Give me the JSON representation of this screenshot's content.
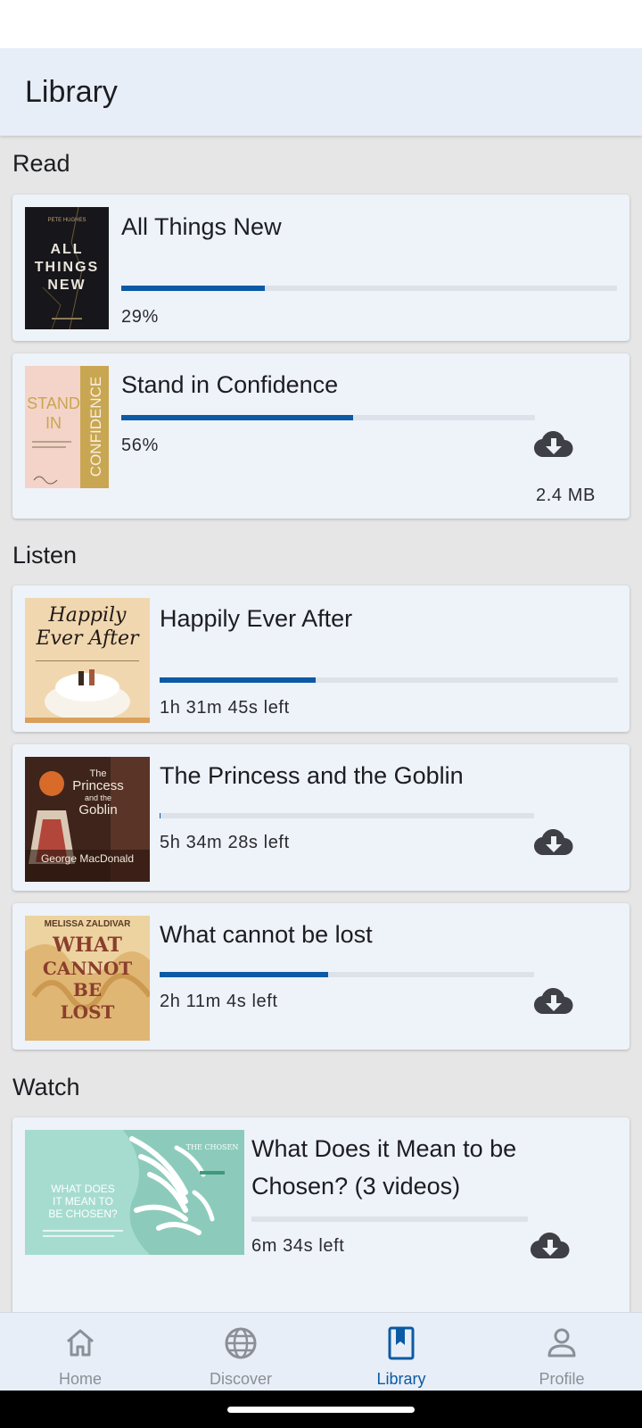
{
  "app_bar": {
    "title": "Library"
  },
  "sections": [
    {
      "title": "Read",
      "items": [
        {
          "title": "All Things New",
          "progress": 0.29,
          "status": "29%",
          "downloadable": false,
          "cover": {
            "author": "PETE HUGHES",
            "lines": [
              "ALL",
              "THINGS",
              "NEW"
            ]
          }
        },
        {
          "title": "Stand in Confidence",
          "progress": 0.56,
          "status": "56%",
          "downloadable": true,
          "size": "2.4 MB",
          "cover": {
            "lines": [
              "STAND",
              "IN"
            ],
            "side": "CONFIDENCE"
          }
        }
      ]
    },
    {
      "title": "Listen",
      "items": [
        {
          "title": "Happily Ever After",
          "progress": 0.34,
          "status": "1h 31m 45s left",
          "downloadable": false,
          "cover": {
            "lines": [
              "Happily",
              "Ever After"
            ]
          }
        },
        {
          "title": "The Princess and the Goblin",
          "progress": 0.003,
          "status": "5h 34m 28s left",
          "downloadable": true,
          "cover": {
            "lines": [
              "The",
              "Princess",
              "and the",
              "Goblin"
            ],
            "author": "George MacDonald"
          }
        },
        {
          "title": "What cannot be lost",
          "progress": 0.45,
          "status": "2h 11m 4s left",
          "downloadable": true,
          "cover": {
            "author": "MELISSA ZALDIVAR",
            "lines": [
              "WHAT",
              "CANNOT",
              "BE",
              "LOST"
            ]
          }
        }
      ]
    },
    {
      "title": "Watch",
      "items": [
        {
          "title": "What Does it Mean to be Chosen? (3 videos)",
          "progress": 0.0,
          "status": "6m 34s left",
          "downloadable": true,
          "cover": {
            "lines": [
              "WHAT DOES",
              "IT MEAN TO",
              "BE CHOSEN?"
            ],
            "badge": "THE CHOSEN"
          }
        }
      ]
    }
  ],
  "bottom_nav": [
    {
      "label": "Home",
      "icon": "home-icon",
      "active": false
    },
    {
      "label": "Discover",
      "icon": "globe-icon",
      "active": false
    },
    {
      "label": "Library",
      "icon": "bookmark-book-icon",
      "active": true
    },
    {
      "label": "Profile",
      "icon": "person-icon",
      "active": false
    }
  ],
  "colors": {
    "accent": "#0b5aa5",
    "card_bg": "#eef2f9",
    "page_bg": "#e6e6e6",
    "track": "#dde2ea"
  }
}
